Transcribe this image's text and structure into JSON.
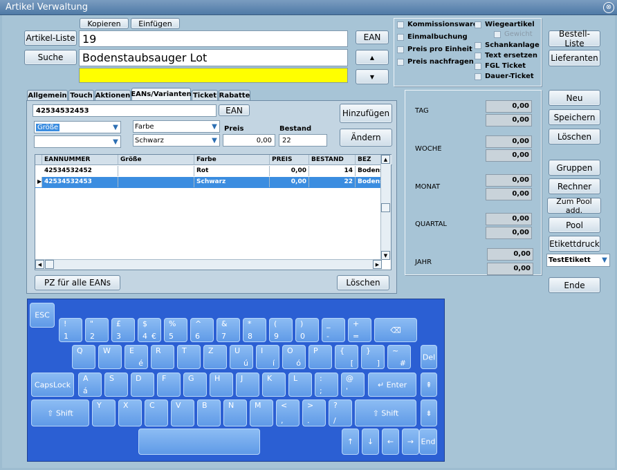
{
  "window": {
    "title": "Artikel Verwaltung",
    "close_glyph": "⊗"
  },
  "top": {
    "kopieren": "Kopieren",
    "einfuegen": "Einfügen",
    "artikel_liste": "Artikel-Liste",
    "suche": "Suche",
    "article_no": "19",
    "article_name": "Bodenstaubsauger Lot",
    "ean": "EAN",
    "up": "▲",
    "down": "▼"
  },
  "options": {
    "col1": [
      "Kommissionsware",
      "Einmalbuchung",
      "Preis pro Einheit",
      "Preis nachfragen"
    ],
    "col2": [
      "Wiegeartikel",
      "Gewicht",
      "Schankanlage",
      "Text ersetzen",
      "FGL Ticket",
      "Dauer-Ticket"
    ]
  },
  "tabs": [
    "Allgemein",
    "Touch",
    "Aktionen",
    "EANs/Varianten",
    "Ticket",
    "Rabatte"
  ],
  "ean_panel": {
    "ean_value": "42534532453",
    "ean_btn": "EAN",
    "hinzufuegen": "Hinzufügen",
    "aendern": "Ändern",
    "groesse": "Größe",
    "groesse2": "",
    "farbe": "Farbe",
    "farbe_value": "Schwarz",
    "preis_label": "Preis",
    "preis_value": "0,00",
    "bestand_label": "Bestand",
    "bestand_value": "22",
    "pz_btn": "PZ für alle EANs",
    "loeschen": "Löschen",
    "grid": {
      "headers": [
        "EANNUMMER",
        "Größe",
        "Farbe",
        "PREIS",
        "BESTAND",
        "BEZ"
      ],
      "rows": [
        {
          "ean": "42534532452",
          "groesse": "",
          "farbe": "Rot",
          "preis": "0,00",
          "bestand": "14",
          "bez": "Bodens"
        },
        {
          "ean": "42534532453",
          "groesse": "",
          "farbe": "Schwarz",
          "preis": "0,00",
          "bestand": "22",
          "bez": "Bodens"
        }
      ]
    }
  },
  "stats": [
    {
      "label": "TAG",
      "v1": "0,00",
      "v2": "0,00"
    },
    {
      "label": "WOCHE",
      "v1": "0,00",
      "v2": "0,00"
    },
    {
      "label": "MONAT",
      "v1": "0,00",
      "v2": "0,00"
    },
    {
      "label": "QUARTAL",
      "v1": "0,00",
      "v2": "0,00"
    },
    {
      "label": "JAHR",
      "v1": "0,00",
      "v2": "0,00"
    }
  ],
  "right_buttons": {
    "bestell_liste": "Bestell-Liste",
    "lieferanten": "Lieferanten",
    "neu": "Neu",
    "speichern": "Speichern",
    "loeschen": "Löschen",
    "gruppen": "Gruppen",
    "rechner": "Rechner",
    "zum_pool": "Zum Pool add.",
    "pool": "Pool",
    "etikettdruck": "Etikettdruck",
    "etikett_select": "TestEtikett",
    "ende": "Ende"
  },
  "keyboard": {
    "esc": "ESC",
    "row1": [
      [
        "!",
        "1"
      ],
      [
        "\"",
        "2"
      ],
      [
        "£",
        "3"
      ],
      [
        "$",
        "4",
        "€"
      ],
      [
        "%",
        "5"
      ],
      [
        "^",
        "6"
      ],
      [
        "&",
        "7"
      ],
      [
        "*",
        "8"
      ],
      [
        "(",
        "9"
      ],
      [
        ")",
        "0"
      ],
      [
        "_",
        "-"
      ],
      [
        "+",
        "="
      ]
    ],
    "backspace": "⌫",
    "row2": [
      [
        "Q",
        ""
      ],
      [
        "W",
        ""
      ],
      [
        "E",
        "é"
      ],
      [
        "R",
        ""
      ],
      [
        "T",
        ""
      ],
      [
        "Z",
        ""
      ],
      [
        "U",
        "ú"
      ],
      [
        "I",
        "í"
      ],
      [
        "O",
        "ó"
      ],
      [
        "P",
        ""
      ],
      [
        "{",
        "["
      ],
      [
        "}",
        "]"
      ],
      [
        "~",
        "#"
      ]
    ],
    "del": "Del",
    "capslock": "CapsLock",
    "row3": [
      [
        "A",
        "á"
      ],
      [
        "S",
        ""
      ],
      [
        "D",
        ""
      ],
      [
        "F",
        ""
      ],
      [
        "G",
        ""
      ],
      [
        "H",
        ""
      ],
      [
        "J",
        ""
      ],
      [
        "K",
        ""
      ],
      [
        "L",
        ""
      ],
      [
        ":",
        ";"
      ],
      [
        "@",
        "'"
      ]
    ],
    "enter": "↵ Enter",
    "pgup": "⇞",
    "shift": "⇧  Shift",
    "row4": [
      [
        "Y",
        ""
      ],
      [
        "X",
        ""
      ],
      [
        "C",
        ""
      ],
      [
        "V",
        ""
      ],
      [
        "B",
        ""
      ],
      [
        "N",
        ""
      ],
      [
        "M",
        ""
      ],
      [
        "<",
        ","
      ],
      [
        ">",
        "."
      ],
      [
        "?",
        "/"
      ]
    ],
    "pgdn": "⇟",
    "arrows": [
      "↑",
      "↓",
      "←",
      "→"
    ],
    "end": "End"
  }
}
